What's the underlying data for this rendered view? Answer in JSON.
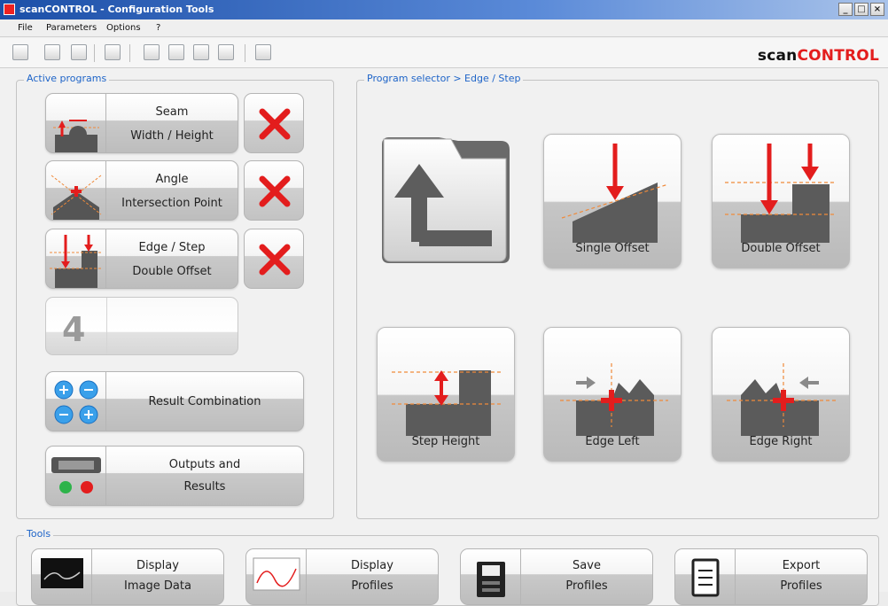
{
  "window": {
    "title": "scanCONTROL - Configuration Tools",
    "min_label": "_",
    "max_label": "□",
    "close_label": "×"
  },
  "menu": {
    "items": [
      "File",
      "Parameters",
      "Options",
      "?"
    ]
  },
  "logo": {
    "part1": "scan",
    "part2": "CONTROL"
  },
  "active_programs": {
    "legend": "Active programs",
    "programs": [
      {
        "line1": "Seam",
        "line2": "Width / Height"
      },
      {
        "line1": "Angle",
        "line2": "Intersection Point"
      },
      {
        "line1": "Edge / Step",
        "line2": "Double Offset"
      }
    ],
    "empty_slot_number": "4",
    "result_combination": "Result Combination",
    "outputs": {
      "line1": "Outputs and",
      "line2": "Results"
    }
  },
  "selector": {
    "legend": "Program selector > Edge / Step",
    "tiles": [
      "Single Offset",
      "Double Offset",
      "Step Height",
      "Edge Left",
      "Edge Right"
    ]
  },
  "tools": {
    "legend": "Tools",
    "items": [
      {
        "line1": "Display",
        "line2": "Image Data"
      },
      {
        "line1": "Display",
        "line2": "Profiles"
      },
      {
        "line1": "Save",
        "line2": "Profiles"
      },
      {
        "line1": "Export",
        "line2": "Profiles"
      }
    ]
  },
  "colors": {
    "accent_blue": "#1e64c8",
    "brand_red": "#e31d1d",
    "marker_orange": "#f08a3a"
  }
}
